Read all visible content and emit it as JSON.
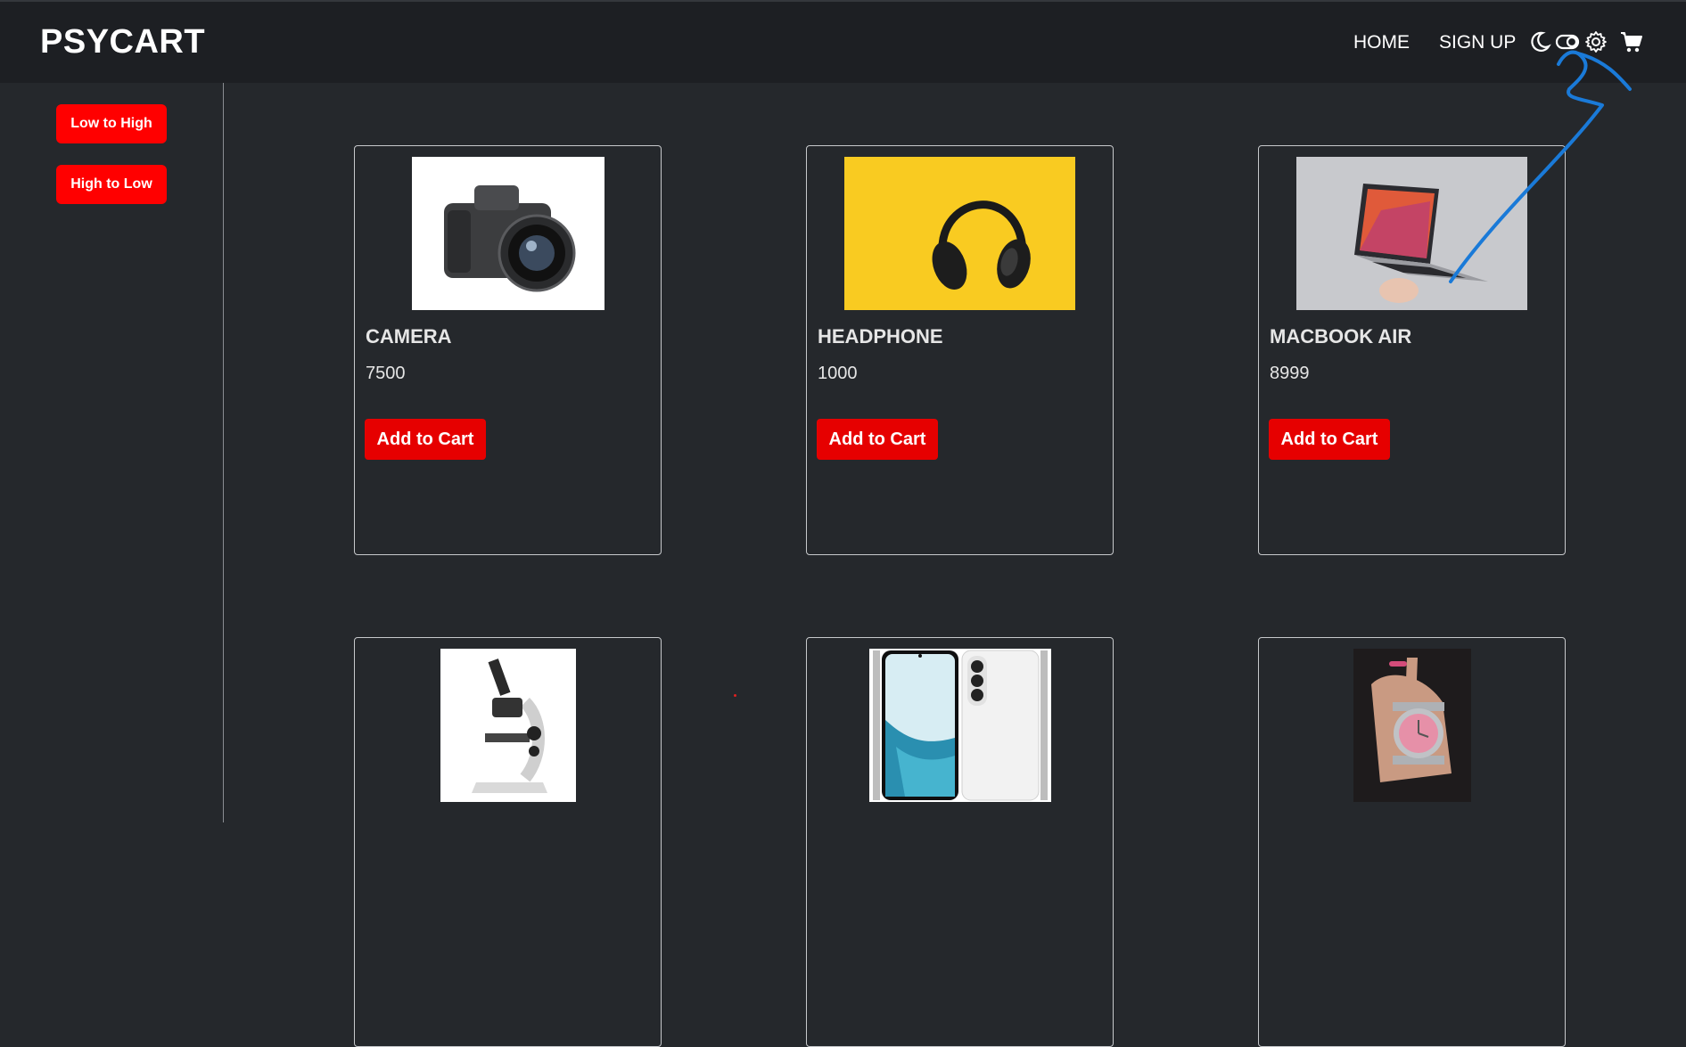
{
  "nav": {
    "brand": "PSYCART",
    "home": "HOME",
    "signup": "SIGN UP",
    "icons": [
      "moon-icon",
      "toggle-icon",
      "gear-icon",
      "cart-icon"
    ]
  },
  "sidebar": {
    "sort_low_high": "Low to High",
    "sort_high_low": "High to Low"
  },
  "products": [
    {
      "name": "CAMERA",
      "price": "7500",
      "button": "Add to Cart",
      "image": "camera"
    },
    {
      "name": "HEADPHONE",
      "price": "1000",
      "button": "Add to Cart",
      "image": "headphone"
    },
    {
      "name": "MACBOOK AIR",
      "price": "8999",
      "button": "Add to Cart",
      "image": "laptop"
    },
    {
      "image": "microscope"
    },
    {
      "image": "smartphone"
    },
    {
      "image": "wristwatch"
    }
  ],
  "colors": {
    "accent": "#ff0000",
    "background": "#25282c",
    "navbar": "#1d1f23",
    "annotation": "#1a7ad8"
  }
}
